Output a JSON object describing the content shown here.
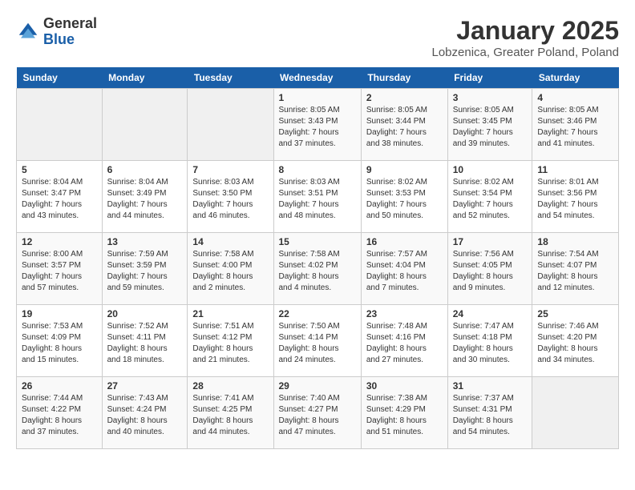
{
  "header": {
    "logo_general": "General",
    "logo_blue": "Blue",
    "month": "January 2025",
    "location": "Lobzenica, Greater Poland, Poland"
  },
  "weekdays": [
    "Sunday",
    "Monday",
    "Tuesday",
    "Wednesday",
    "Thursday",
    "Friday",
    "Saturday"
  ],
  "weeks": [
    [
      {
        "day": "",
        "empty": true
      },
      {
        "day": "",
        "empty": true
      },
      {
        "day": "",
        "empty": true
      },
      {
        "day": "1",
        "info": "Sunrise: 8:05 AM\nSunset: 3:43 PM\nDaylight: 7 hours\nand 37 minutes."
      },
      {
        "day": "2",
        "info": "Sunrise: 8:05 AM\nSunset: 3:44 PM\nDaylight: 7 hours\nand 38 minutes."
      },
      {
        "day": "3",
        "info": "Sunrise: 8:05 AM\nSunset: 3:45 PM\nDaylight: 7 hours\nand 39 minutes."
      },
      {
        "day": "4",
        "info": "Sunrise: 8:05 AM\nSunset: 3:46 PM\nDaylight: 7 hours\nand 41 minutes."
      }
    ],
    [
      {
        "day": "5",
        "info": "Sunrise: 8:04 AM\nSunset: 3:47 PM\nDaylight: 7 hours\nand 43 minutes."
      },
      {
        "day": "6",
        "info": "Sunrise: 8:04 AM\nSunset: 3:49 PM\nDaylight: 7 hours\nand 44 minutes."
      },
      {
        "day": "7",
        "info": "Sunrise: 8:03 AM\nSunset: 3:50 PM\nDaylight: 7 hours\nand 46 minutes."
      },
      {
        "day": "8",
        "info": "Sunrise: 8:03 AM\nSunset: 3:51 PM\nDaylight: 7 hours\nand 48 minutes."
      },
      {
        "day": "9",
        "info": "Sunrise: 8:02 AM\nSunset: 3:53 PM\nDaylight: 7 hours\nand 50 minutes."
      },
      {
        "day": "10",
        "info": "Sunrise: 8:02 AM\nSunset: 3:54 PM\nDaylight: 7 hours\nand 52 minutes."
      },
      {
        "day": "11",
        "info": "Sunrise: 8:01 AM\nSunset: 3:56 PM\nDaylight: 7 hours\nand 54 minutes."
      }
    ],
    [
      {
        "day": "12",
        "info": "Sunrise: 8:00 AM\nSunset: 3:57 PM\nDaylight: 7 hours\nand 57 minutes."
      },
      {
        "day": "13",
        "info": "Sunrise: 7:59 AM\nSunset: 3:59 PM\nDaylight: 7 hours\nand 59 minutes."
      },
      {
        "day": "14",
        "info": "Sunrise: 7:58 AM\nSunset: 4:00 PM\nDaylight: 8 hours\nand 2 minutes."
      },
      {
        "day": "15",
        "info": "Sunrise: 7:58 AM\nSunset: 4:02 PM\nDaylight: 8 hours\nand 4 minutes."
      },
      {
        "day": "16",
        "info": "Sunrise: 7:57 AM\nSunset: 4:04 PM\nDaylight: 8 hours\nand 7 minutes."
      },
      {
        "day": "17",
        "info": "Sunrise: 7:56 AM\nSunset: 4:05 PM\nDaylight: 8 hours\nand 9 minutes."
      },
      {
        "day": "18",
        "info": "Sunrise: 7:54 AM\nSunset: 4:07 PM\nDaylight: 8 hours\nand 12 minutes."
      }
    ],
    [
      {
        "day": "19",
        "info": "Sunrise: 7:53 AM\nSunset: 4:09 PM\nDaylight: 8 hours\nand 15 minutes."
      },
      {
        "day": "20",
        "info": "Sunrise: 7:52 AM\nSunset: 4:11 PM\nDaylight: 8 hours\nand 18 minutes."
      },
      {
        "day": "21",
        "info": "Sunrise: 7:51 AM\nSunset: 4:12 PM\nDaylight: 8 hours\nand 21 minutes."
      },
      {
        "day": "22",
        "info": "Sunrise: 7:50 AM\nSunset: 4:14 PM\nDaylight: 8 hours\nand 24 minutes."
      },
      {
        "day": "23",
        "info": "Sunrise: 7:48 AM\nSunset: 4:16 PM\nDaylight: 8 hours\nand 27 minutes."
      },
      {
        "day": "24",
        "info": "Sunrise: 7:47 AM\nSunset: 4:18 PM\nDaylight: 8 hours\nand 30 minutes."
      },
      {
        "day": "25",
        "info": "Sunrise: 7:46 AM\nSunset: 4:20 PM\nDaylight: 8 hours\nand 34 minutes."
      }
    ],
    [
      {
        "day": "26",
        "info": "Sunrise: 7:44 AM\nSunset: 4:22 PM\nDaylight: 8 hours\nand 37 minutes."
      },
      {
        "day": "27",
        "info": "Sunrise: 7:43 AM\nSunset: 4:24 PM\nDaylight: 8 hours\nand 40 minutes."
      },
      {
        "day": "28",
        "info": "Sunrise: 7:41 AM\nSunset: 4:25 PM\nDaylight: 8 hours\nand 44 minutes."
      },
      {
        "day": "29",
        "info": "Sunrise: 7:40 AM\nSunset: 4:27 PM\nDaylight: 8 hours\nand 47 minutes."
      },
      {
        "day": "30",
        "info": "Sunrise: 7:38 AM\nSunset: 4:29 PM\nDaylight: 8 hours\nand 51 minutes."
      },
      {
        "day": "31",
        "info": "Sunrise: 7:37 AM\nSunset: 4:31 PM\nDaylight: 8 hours\nand 54 minutes."
      },
      {
        "day": "",
        "empty": true
      }
    ]
  ]
}
